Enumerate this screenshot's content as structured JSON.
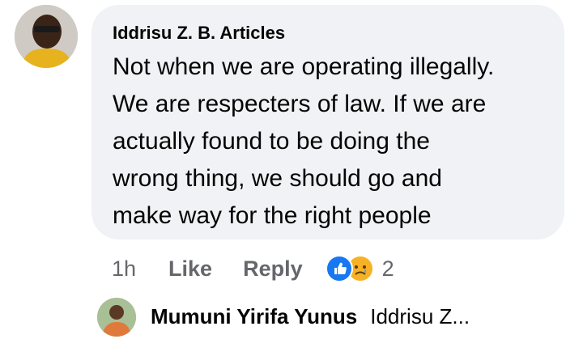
{
  "comment": {
    "author": "Iddrisu Z. B. Articles",
    "text_lines": [
      "Not when we are operating illegally.",
      "We are respecters of law. If we are",
      "actually found to be doing the",
      "wrong thing, we should go and",
      "make way for the right people"
    ],
    "time": "1h",
    "like_label": "Like",
    "reply_label": "Reply",
    "reaction_count": "2",
    "reactions": [
      "like-icon",
      "sad-face-icon"
    ]
  },
  "reply": {
    "author": "Mumuni Yirifa Yunus",
    "preview": "Iddrisu Z..."
  },
  "colors": {
    "bubble_bg": "#f0f2f5",
    "meta_text": "#65676b",
    "like_blue": "#1877f2",
    "sad_yellow": "#f7b125"
  }
}
